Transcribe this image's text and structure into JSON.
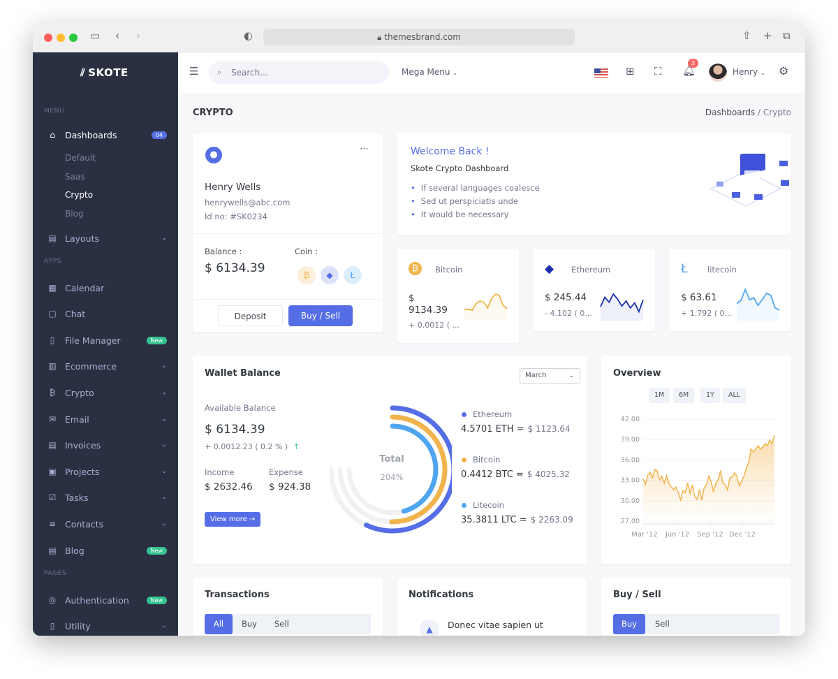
{
  "browser": {
    "url": "themesbrand.com"
  },
  "sidebar": {
    "logo": "SKOTE",
    "menu_title": "MENU",
    "apps_title": "APPS",
    "pages_title": "PAGES",
    "dashboards": {
      "label": "Dashboards",
      "badge": "04",
      "children": [
        "Default",
        "Saas",
        "Crypto",
        "Blog"
      ],
      "active": "Crypto"
    },
    "items": [
      {
        "label": "Layouts",
        "icon": "layout-icon",
        "chevron": true
      },
      {
        "label": "Calendar",
        "icon": "calendar-icon"
      },
      {
        "label": "Chat",
        "icon": "chat-icon"
      },
      {
        "label": "File Manager",
        "icon": "file-icon",
        "badge": "New"
      },
      {
        "label": "Ecommerce",
        "icon": "store-icon",
        "chevron": true
      },
      {
        "label": "Crypto",
        "icon": "bitcoin-icon",
        "chevron": true
      },
      {
        "label": "Email",
        "icon": "mail-icon",
        "chevron": true
      },
      {
        "label": "Invoices",
        "icon": "invoice-icon",
        "chevron": true
      },
      {
        "label": "Projects",
        "icon": "briefcase-icon",
        "chevron": true
      },
      {
        "label": "Tasks",
        "icon": "task-icon",
        "chevron": true
      },
      {
        "label": "Contacts",
        "icon": "contacts-icon",
        "chevron": true
      },
      {
        "label": "Blog",
        "icon": "blog-icon",
        "badge": "New"
      },
      {
        "label": "Authentication",
        "icon": "user-circle-icon",
        "badge": "New"
      },
      {
        "label": "Utility",
        "icon": "utility-icon",
        "chevron": true
      }
    ]
  },
  "header": {
    "search_placeholder": "Search...",
    "mega_menu": "Mega Menu",
    "notif_count": "3",
    "user": "Henry"
  },
  "page": {
    "title": "CRYPTO",
    "breadcrumb": [
      "Dashboards",
      "Crypto"
    ]
  },
  "profile": {
    "name": "Henry Wells",
    "email": "henrywells@abc.com",
    "id": "Id no: #SK0234",
    "balance_label": "Balance :",
    "balance": "$ 6134.39",
    "coin_label": "Coin :",
    "deposit": "Deposit",
    "buysell": "Buy / Sell"
  },
  "welcome": {
    "title": "Welcome Back !",
    "subtitle": "Skote Crypto Dashboard",
    "bullets": [
      "If several languages coalesce",
      "Sed ut perspiciatis unde",
      "It would be necessary"
    ]
  },
  "coins": [
    {
      "name": "Bitcoin",
      "price": "$ 9134.39",
      "change": "+ 0.0012 ( ...",
      "color": "#f1b44c",
      "spark": [
        3,
        3.2,
        2.8,
        5,
        5.8,
        5.4,
        3.6,
        6.5,
        8,
        7.6,
        4.4,
        3.4
      ]
    },
    {
      "name": "Ethereum",
      "price": "$ 245.44",
      "change": "- 4.102 ( 0...",
      "color": "#1a2dad",
      "spark": [
        4,
        7,
        5.4,
        8,
        6.4,
        4.2,
        5.8,
        3.6,
        5.2,
        2.4,
        6.2
      ]
    },
    {
      "name": "litecoin",
      "price": "$ 63.61",
      "change": "+ 1.792 ( 0...",
      "color": "#50a5f1",
      "spark": [
        5,
        6,
        9.5,
        6.2,
        6.8,
        4.4,
        6.3,
        8.3,
        7.6,
        3.6,
        2.9
      ]
    }
  ],
  "wallet": {
    "title": "Wallet Balance",
    "month": "March",
    "avail_label": "Available Balance",
    "avail": "$ 6134.39",
    "change": "+ 0.0012.23 ( 0.2 % )",
    "income_label": "Income",
    "income": "$ 2632.46",
    "expense_label": "Expense",
    "expense": "$ 924.38",
    "view_more": "View more",
    "total_label": "Total",
    "total": "204%",
    "legend": [
      {
        "name": "Ethereum",
        "amount": "4.5701 ETH =",
        "usd": "$ 1123.64",
        "color": "#556ee6",
        "percent": 76
      },
      {
        "name": "Bitcoin",
        "amount": "0.4412 BTC =",
        "usd": "$ 4025.32",
        "color": "#f1b44c",
        "percent": 67
      },
      {
        "name": "Litecoin",
        "amount": "35.3811 LTC =",
        "usd": "$ 2263.09",
        "color": "#50a5f1",
        "percent": 61
      }
    ]
  },
  "chart_data": {
    "type": "area",
    "title": "Overview",
    "ranges": [
      "1M",
      "6M",
      "1Y",
      "ALL"
    ],
    "ylim": [
      27,
      42
    ],
    "yticks": [
      "42.00",
      "39.00",
      "36.00",
      "33.00",
      "30.00",
      "27.00"
    ],
    "xticks": [
      "Mar '12",
      "Jun '12",
      "Sep '12",
      "Dec '12"
    ],
    "color": "#f1b44c",
    "grid": true,
    "values": [
      33.2,
      32.4,
      33.8,
      34.2,
      33.4,
      34.6,
      34.4,
      33.1,
      33.6,
      32.6,
      33.7,
      32.5,
      32.1,
      31.6,
      32,
      31.2,
      30.1,
      31.5,
      31.2,
      32.6,
      31.1,
      32.3,
      30.6,
      30.2,
      31.6,
      30.1,
      31.9,
      32.4,
      33.6,
      32.8,
      31.3,
      32.6,
      33.1,
      34.4,
      32.6,
      32.4,
      31.6,
      33.4,
      33.5,
      34.1,
      33.6,
      32.2,
      32.9,
      33.6,
      34.8,
      35.6,
      37.6,
      37.2,
      37.6,
      38.1,
      37.6,
      37.9,
      38.4,
      38.1,
      38.9,
      38.4,
      39.6
    ]
  },
  "transactions": {
    "title": "Transactions",
    "tabs": [
      "All",
      "Buy",
      "Sell"
    ]
  },
  "notifications": {
    "title": "Notifications",
    "first": "Donec vitae sapien ut"
  },
  "buysell": {
    "title": "Buy / Sell",
    "tabs": [
      "Buy",
      "Sell"
    ]
  }
}
